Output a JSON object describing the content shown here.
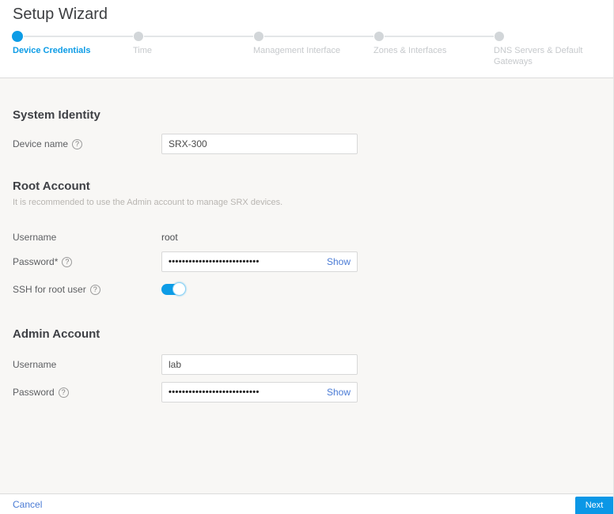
{
  "title": "Setup Wizard",
  "colors": {
    "accent_blue": "#0d9ce6",
    "link_blue": "#4a7bd5",
    "next_button_blue": "#0b97e6",
    "content_background": "#f8f7f5"
  },
  "icons": {
    "help_glyph": "?"
  },
  "stepper": {
    "steps": [
      {
        "label": "Device Credentials",
        "state": "active"
      },
      {
        "label": "Time",
        "state": "upcoming"
      },
      {
        "label": "Management Interface",
        "state": "upcoming"
      },
      {
        "label": "Zones & Interfaces",
        "state": "upcoming"
      },
      {
        "label": "DNS Servers & Default Gateways",
        "state": "upcoming"
      }
    ]
  },
  "sections": {
    "system_identity": {
      "heading": "System Identity",
      "device_name": {
        "label": "Device name",
        "value": "SRX-300"
      }
    },
    "root_account": {
      "heading": "Root Account",
      "subtitle": "It is recommended to use the Admin account to manage SRX devices.",
      "username": {
        "label": "Username",
        "value": "root"
      },
      "password": {
        "label": "Password*",
        "masked_value": "•••••••••••••••••••••••••••",
        "show_label": "Show"
      },
      "ssh": {
        "label": "SSH for root user",
        "state": "on"
      }
    },
    "admin_account": {
      "heading": "Admin Account",
      "username": {
        "label": "Username",
        "value": "lab"
      },
      "password": {
        "label": "Password",
        "masked_value": "•••••••••••••••••••••••••••",
        "show_label": "Show"
      }
    }
  },
  "footer": {
    "cancel_label": "Cancel",
    "next_label": "Next"
  }
}
